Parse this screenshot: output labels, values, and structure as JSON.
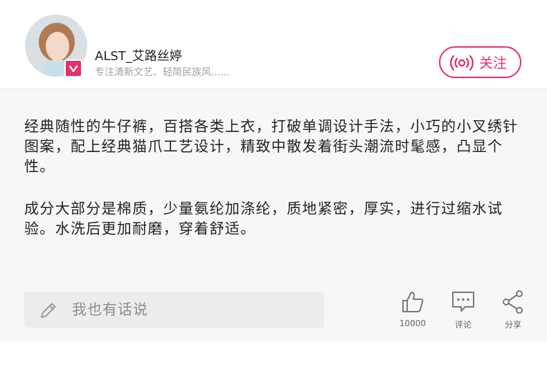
{
  "user": {
    "name": "ALST_艾路丝婷",
    "bio": "专注清新文艺、轻简民族风......"
  },
  "follow": {
    "label": "关注"
  },
  "post": {
    "paragraphs": [
      "经典随性的牛仔裤，百搭各类上衣，打破单调设计手法，小巧的小叉绣针图案，配上经典猫爪工艺设计，精致中散发着街头潮流时髦感，凸显个性。",
      "成分大部分是棉质，少量氨纶加涤纶，质地紧密，厚实，进行过缩水试验。水洗后更加耐磨，穿着舒适。"
    ]
  },
  "comment": {
    "placeholder": "我也有话说"
  },
  "actions": {
    "like_count": "10000",
    "comment_label": "评论",
    "share_label": "分享"
  },
  "colors": {
    "accent": "#e6306c",
    "content_bg": "#f7f7f7"
  }
}
